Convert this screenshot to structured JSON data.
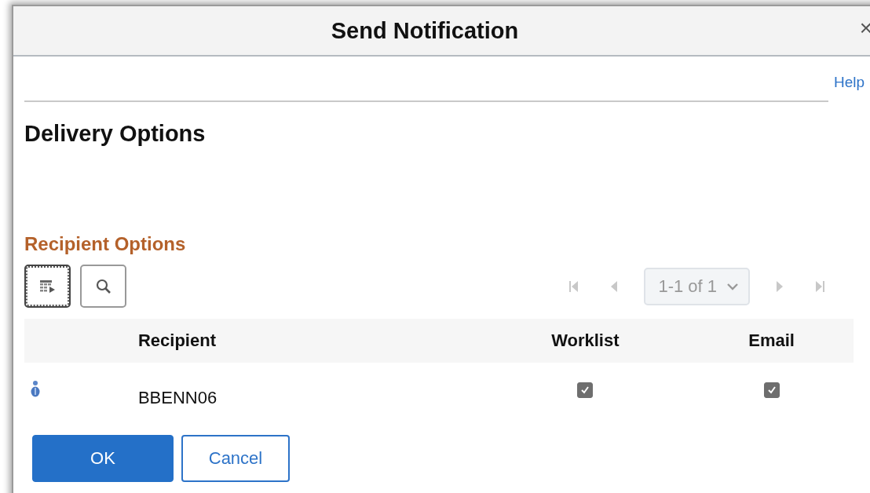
{
  "window": {
    "title": "Send Notification",
    "close": "×"
  },
  "help_link": "Help",
  "heading": "Delivery Options",
  "section_title": "Recipient Options",
  "grid_toolbar": {
    "pager": {
      "range": "1-1 of 1",
      "first_disabled": true,
      "prev_disabled": true,
      "next_disabled": true,
      "last_disabled": true
    }
  },
  "table": {
    "columns": [
      "Recipient",
      "Worklist",
      "Email"
    ],
    "rows": [
      {
        "recipient": "BBENN06",
        "worklist": {
          "checked": true,
          "disabled": true
        },
        "email": {
          "checked": true,
          "disabled": true
        }
      }
    ]
  },
  "buttons": [
    {
      "label": "OK",
      "kind": "primary"
    },
    {
      "label": "Cancel",
      "kind": "secondary"
    }
  ]
}
